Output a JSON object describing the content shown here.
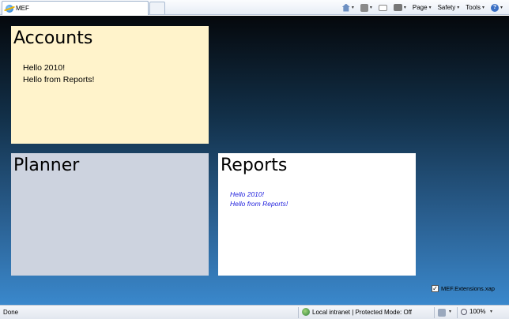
{
  "browser": {
    "tab_title": "MEF",
    "toolbar": {
      "page_label": "Page",
      "safety_label": "Safety",
      "tools_label": "Tools",
      "dropdown_glyph": "▾",
      "help_glyph": "?"
    },
    "icons": [
      "ie-icon",
      "home-icon",
      "feed-icon",
      "mail-icon",
      "print-icon",
      "help-icon"
    ]
  },
  "app": {
    "panels": {
      "accounts": {
        "title": "Accounts",
        "messages": [
          "Hello 2010!",
          "Hello from Reports!"
        ],
        "background": "#fff3cb"
      },
      "planner": {
        "title": "Planner",
        "background": "#cdd3df"
      },
      "reports": {
        "title": "Reports",
        "messages": [
          "Hello 2010!",
          "Hello from Reports!"
        ],
        "message_color": "#2222dd",
        "background": "#ffffff"
      }
    },
    "extension": {
      "label": "MEF.Extensions.xap",
      "checked": true,
      "check_glyph": "✓"
    }
  },
  "statusbar": {
    "status": "Done",
    "zone": "Local intranet | Protected Mode: Off",
    "zoom": "100%",
    "dropdown_glyph": "▾"
  }
}
